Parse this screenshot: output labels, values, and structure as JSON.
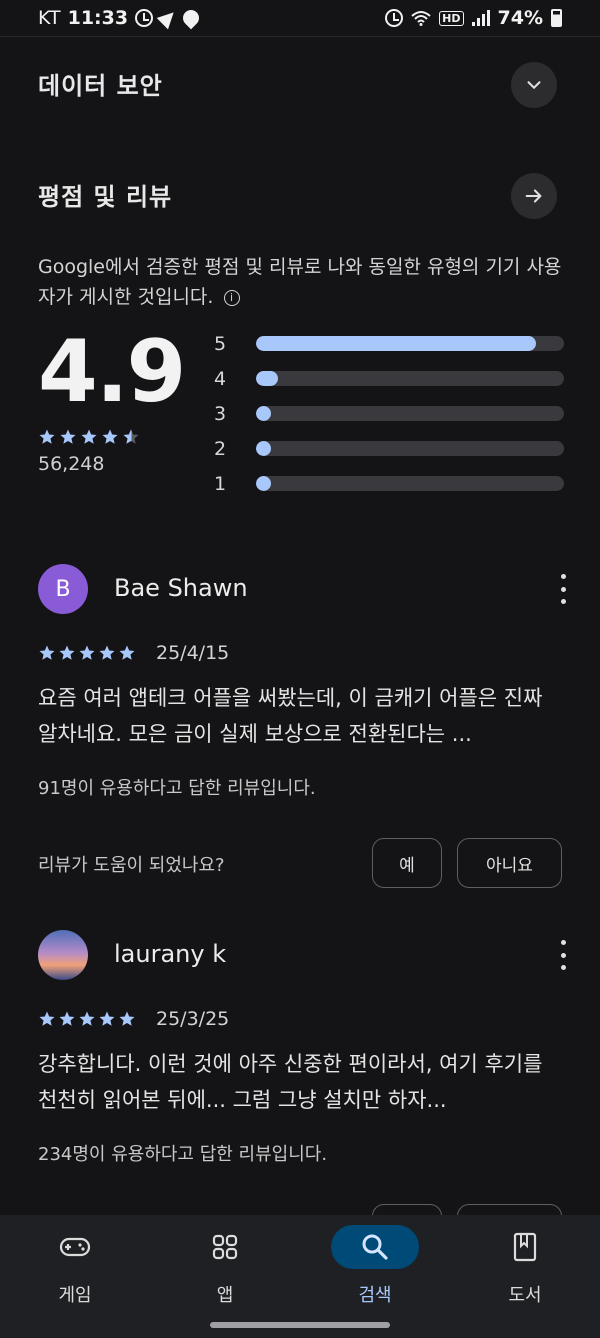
{
  "status_bar": {
    "carrier": "KT",
    "time": "11:33",
    "network": "HD",
    "battery": "74%"
  },
  "data_safety": {
    "title": "데이터 보안"
  },
  "ratings": {
    "title": "평점 및 리뷰",
    "description": "Google에서 검증한 평점 및 리뷰로 나와 동일한 유형의 기기 사용자가 게시한 것입니다.",
    "average": "4.9",
    "average_stars": 4.5,
    "count": "56,248",
    "distribution": [
      {
        "label": "5",
        "fraction": 0.91
      },
      {
        "label": "4",
        "fraction": 0.07
      },
      {
        "label": "3",
        "fraction": 0.02
      },
      {
        "label": "2",
        "fraction": 0.02
      },
      {
        "label": "1",
        "fraction": 0.02
      }
    ]
  },
  "reviews": [
    {
      "avatar_letter": "B",
      "name": "Bae Shawn",
      "stars": 5,
      "date": "25/4/15",
      "text": "요즘 여러 앱테크 어플을 써봤는데, 이 금캐기 어플은 진짜 알차네요. 모은 금이 실제 보상으로 전환된다는 ...",
      "helpful": "91명이 유용하다고 답한 리뷰입니다.",
      "ask": "리뷰가 도움이 되었나요?",
      "yes_label": "예",
      "no_label": "아니요"
    },
    {
      "avatar_letter": "",
      "name": "laurany k",
      "stars": 5,
      "date": "25/3/25",
      "text": "강추합니다. 이런 것에 아주 신중한 편이라서, 여기 후기를 천천히 읽어본 뒤에... 그럼 그냥 설치만 하자...",
      "helpful": "234명이 유용하다고 답한 리뷰입니다."
    }
  ],
  "bottom_nav": {
    "items": [
      {
        "label": "게임",
        "icon": "gamepad-icon",
        "active": false
      },
      {
        "label": "앱",
        "icon": "apps-grid-icon",
        "active": false
      },
      {
        "label": "검색",
        "icon": "search-icon",
        "active": true
      },
      {
        "label": "도서",
        "icon": "book-icon",
        "active": false
      }
    ]
  },
  "colors": {
    "accent": "#a8c7fa",
    "active_nav_bg": "#004a77",
    "background": "#141416"
  }
}
